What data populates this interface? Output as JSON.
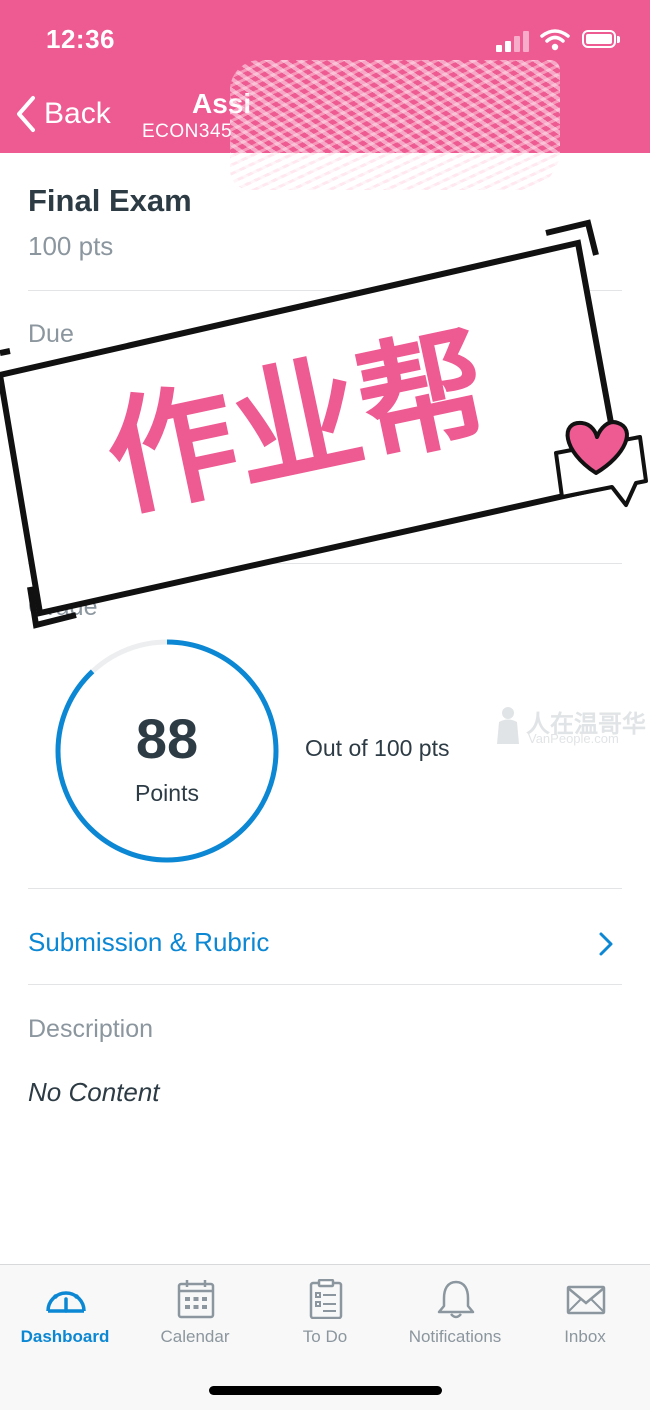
{
  "status_bar": {
    "time": "12:36"
  },
  "nav": {
    "back_label": "Back",
    "title": "Assi",
    "subtitle": "ECON345"
  },
  "assignment": {
    "title": "Final Exam",
    "points": "100 pts"
  },
  "sections": {
    "due_label": "Due",
    "grade_label": "Grade",
    "description_label": "Description"
  },
  "grade": {
    "score": "88",
    "unit": "Points",
    "out_of": "Out of 100 pts",
    "fraction": 0.88,
    "ring_color": "#0b87d3"
  },
  "submission": {
    "label": "Submission & Rubric"
  },
  "description": {
    "text": "No Content"
  },
  "watermarks": {
    "stamp_text": "作业帮",
    "site_text": "人在温哥华",
    "site_sub": "VanPeople.com"
  },
  "tabs": [
    {
      "label": "Dashboard",
      "icon": "dashboard-icon",
      "active": true
    },
    {
      "label": "Calendar",
      "icon": "calendar-icon",
      "active": false
    },
    {
      "label": "To Do",
      "icon": "todo-icon",
      "active": false
    },
    {
      "label": "Notifications",
      "icon": "bell-icon",
      "active": false
    },
    {
      "label": "Inbox",
      "icon": "envelope-icon",
      "active": false
    }
  ],
  "colors": {
    "brand": "#ee5a92",
    "accent": "#0b87d3",
    "text": "#2d3b45",
    "muted": "#8b969e"
  }
}
